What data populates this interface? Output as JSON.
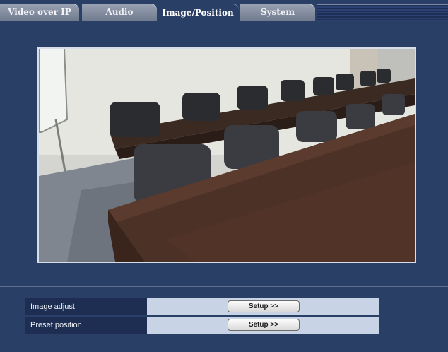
{
  "tabs": [
    {
      "label": "Video over IP",
      "active": false
    },
    {
      "label": "Audio",
      "active": false
    },
    {
      "label": "Image/Position",
      "active": true
    },
    {
      "label": "System",
      "active": false
    }
  ],
  "camera_view": {
    "icon": "conference-room-image"
  },
  "settings": [
    {
      "label": "Image adjust",
      "button_label": "Setup >>"
    },
    {
      "label": "Preset position",
      "button_label": "Setup >>"
    }
  ],
  "colors": {
    "background": "#2a3f66",
    "tab_inactive": "#8a94a6",
    "label_cell": "#1e2e52",
    "value_cell": "#c9d3e6"
  }
}
